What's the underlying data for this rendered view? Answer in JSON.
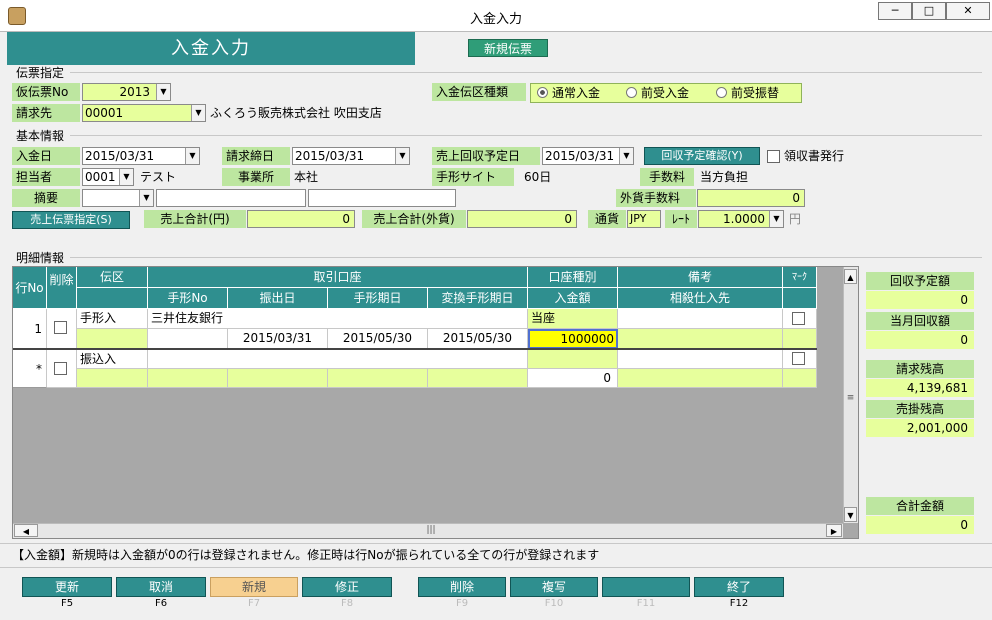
{
  "window": {
    "title": "入金入力",
    "minimize": "─",
    "maximize": "□",
    "close": "✕"
  },
  "header": {
    "title": "入金入力",
    "new_slip": "新規伝票"
  },
  "slip": {
    "section": "伝票指定",
    "temp_no_label": "仮伝票No",
    "temp_no": "2013",
    "customer_label": "請求先",
    "customer_code": "00001",
    "customer_name": "ふくろう販売株式会社 吹田支店",
    "type_label": "入金伝区種類",
    "types": [
      "通常入金",
      "前受入金",
      "前受振替"
    ],
    "type_selected": "通常入金"
  },
  "basic": {
    "section": "基本情報",
    "date_label": "入金日",
    "date": "2015/03/31",
    "close_label": "請求締日",
    "close_date": "2015/03/31",
    "due_label": "売上回収予定日",
    "due_date": "2015/03/31",
    "confirm_btn": "回収予定確認(Y)",
    "receipt_label": "領収書発行",
    "staff_label": "担当者",
    "staff_code": "0001",
    "staff_name": "テスト",
    "office_label": "事業所",
    "office": "本社",
    "bill_site_label": "手形サイト",
    "bill_site": "60日",
    "fee_label": "手数料",
    "fee": "当方負担",
    "summary_label": "摘要",
    "fx_fee_label": "外貨手数料",
    "fx_fee": "0",
    "sales_slip_btn": "売上伝票指定(S)",
    "sales_total_label": "売上合計(円)",
    "sales_total": "0",
    "sales_total_fx_label": "売上合計(外貨)",
    "sales_total_fx": "0",
    "currency_label": "通貨",
    "currency": "JPY",
    "rate_label": "ﾚｰﾄ",
    "rate": "1.0000",
    "rate_unit": "円"
  },
  "detail": {
    "section": "明細情報",
    "headers": {
      "row_no": "行No",
      "delete": "削除",
      "slip_type": "伝区",
      "account": "取引口座",
      "account_type": "口座種別",
      "note": "備考",
      "mark": "ﾏｰｸ",
      "bill_no": "手形No",
      "issue_date": "振出日",
      "bill_due": "手形期日",
      "changed_due": "変換手形期日",
      "amount": "入金額",
      "offset": "相殺仕入先"
    },
    "rows": [
      {
        "no": "1",
        "slip_type": "手形入",
        "bank": "三井住友銀行",
        "account_type": "当座",
        "issue_date": "2015/03/31",
        "bill_due": "2015/05/30",
        "changed_due": "2015/05/30",
        "amount": "1000000"
      },
      {
        "no": "*",
        "slip_type": "振込入",
        "bank": "",
        "account_type": "",
        "issue_date": "",
        "bill_due": "",
        "changed_due": "",
        "amount": "0"
      }
    ]
  },
  "side": {
    "scheduled_label": "回収予定額",
    "scheduled": "0",
    "month_label": "当月回収額",
    "month": "0",
    "bill_balance_label": "請求残高",
    "bill_balance": "4,139,681",
    "ar_balance_label": "売掛残高",
    "ar_balance": "2,001,000",
    "total_label": "合計金額",
    "total": "0"
  },
  "status_message": "【入金額】新規時は入金額が0の行は登録されません。修正時は行Noが振られている全ての行が登録されます",
  "fkeys": [
    {
      "label": "更新",
      "key": "F5"
    },
    {
      "label": "取消",
      "key": "F6"
    },
    {
      "label": "新規",
      "key": "F7"
    },
    {
      "label": "修正",
      "key": "F8"
    },
    {
      "label": "削除",
      "key": "F9"
    },
    {
      "label": "複写",
      "key": "F10"
    },
    {
      "label": "",
      "key": "F11"
    },
    {
      "label": "終了",
      "key": "F12"
    }
  ],
  "colors": {
    "teal": "#2f8f8f",
    "label_green": "#bde6a0",
    "input_yellow": "#e7ff9c",
    "highlight": "#ffff00"
  }
}
